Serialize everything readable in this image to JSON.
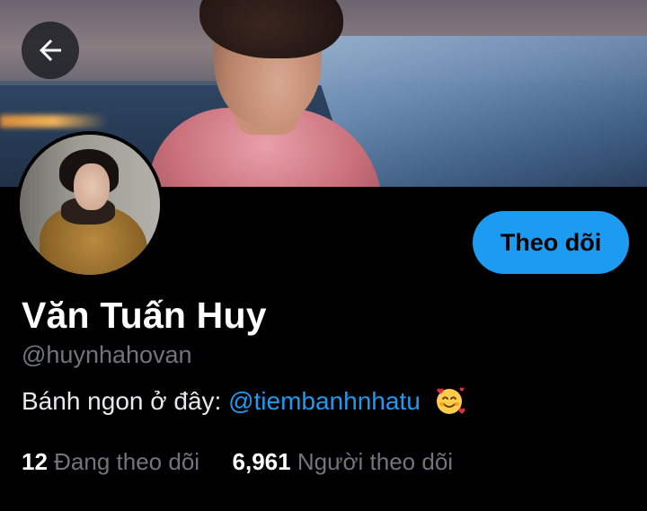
{
  "profile": {
    "display_name": "Văn Tuấn Huy",
    "handle": "@huynhahovan",
    "bio_text": "Bánh ngon ở đây: ",
    "bio_mention": "@tiembanhnhatu",
    "bio_emoji": "smiling-face-with-hearts-emoji"
  },
  "actions": {
    "follow_label": "Theo dõi",
    "back_icon": "arrow-left-icon"
  },
  "stats": {
    "following_count": "12",
    "following_label": "Đang theo dõi",
    "followers_count": "6,961",
    "followers_label": "Người theo dõi"
  },
  "colors": {
    "accent": "#1d9bf0",
    "background": "#000000",
    "muted_text": "#71767b"
  }
}
